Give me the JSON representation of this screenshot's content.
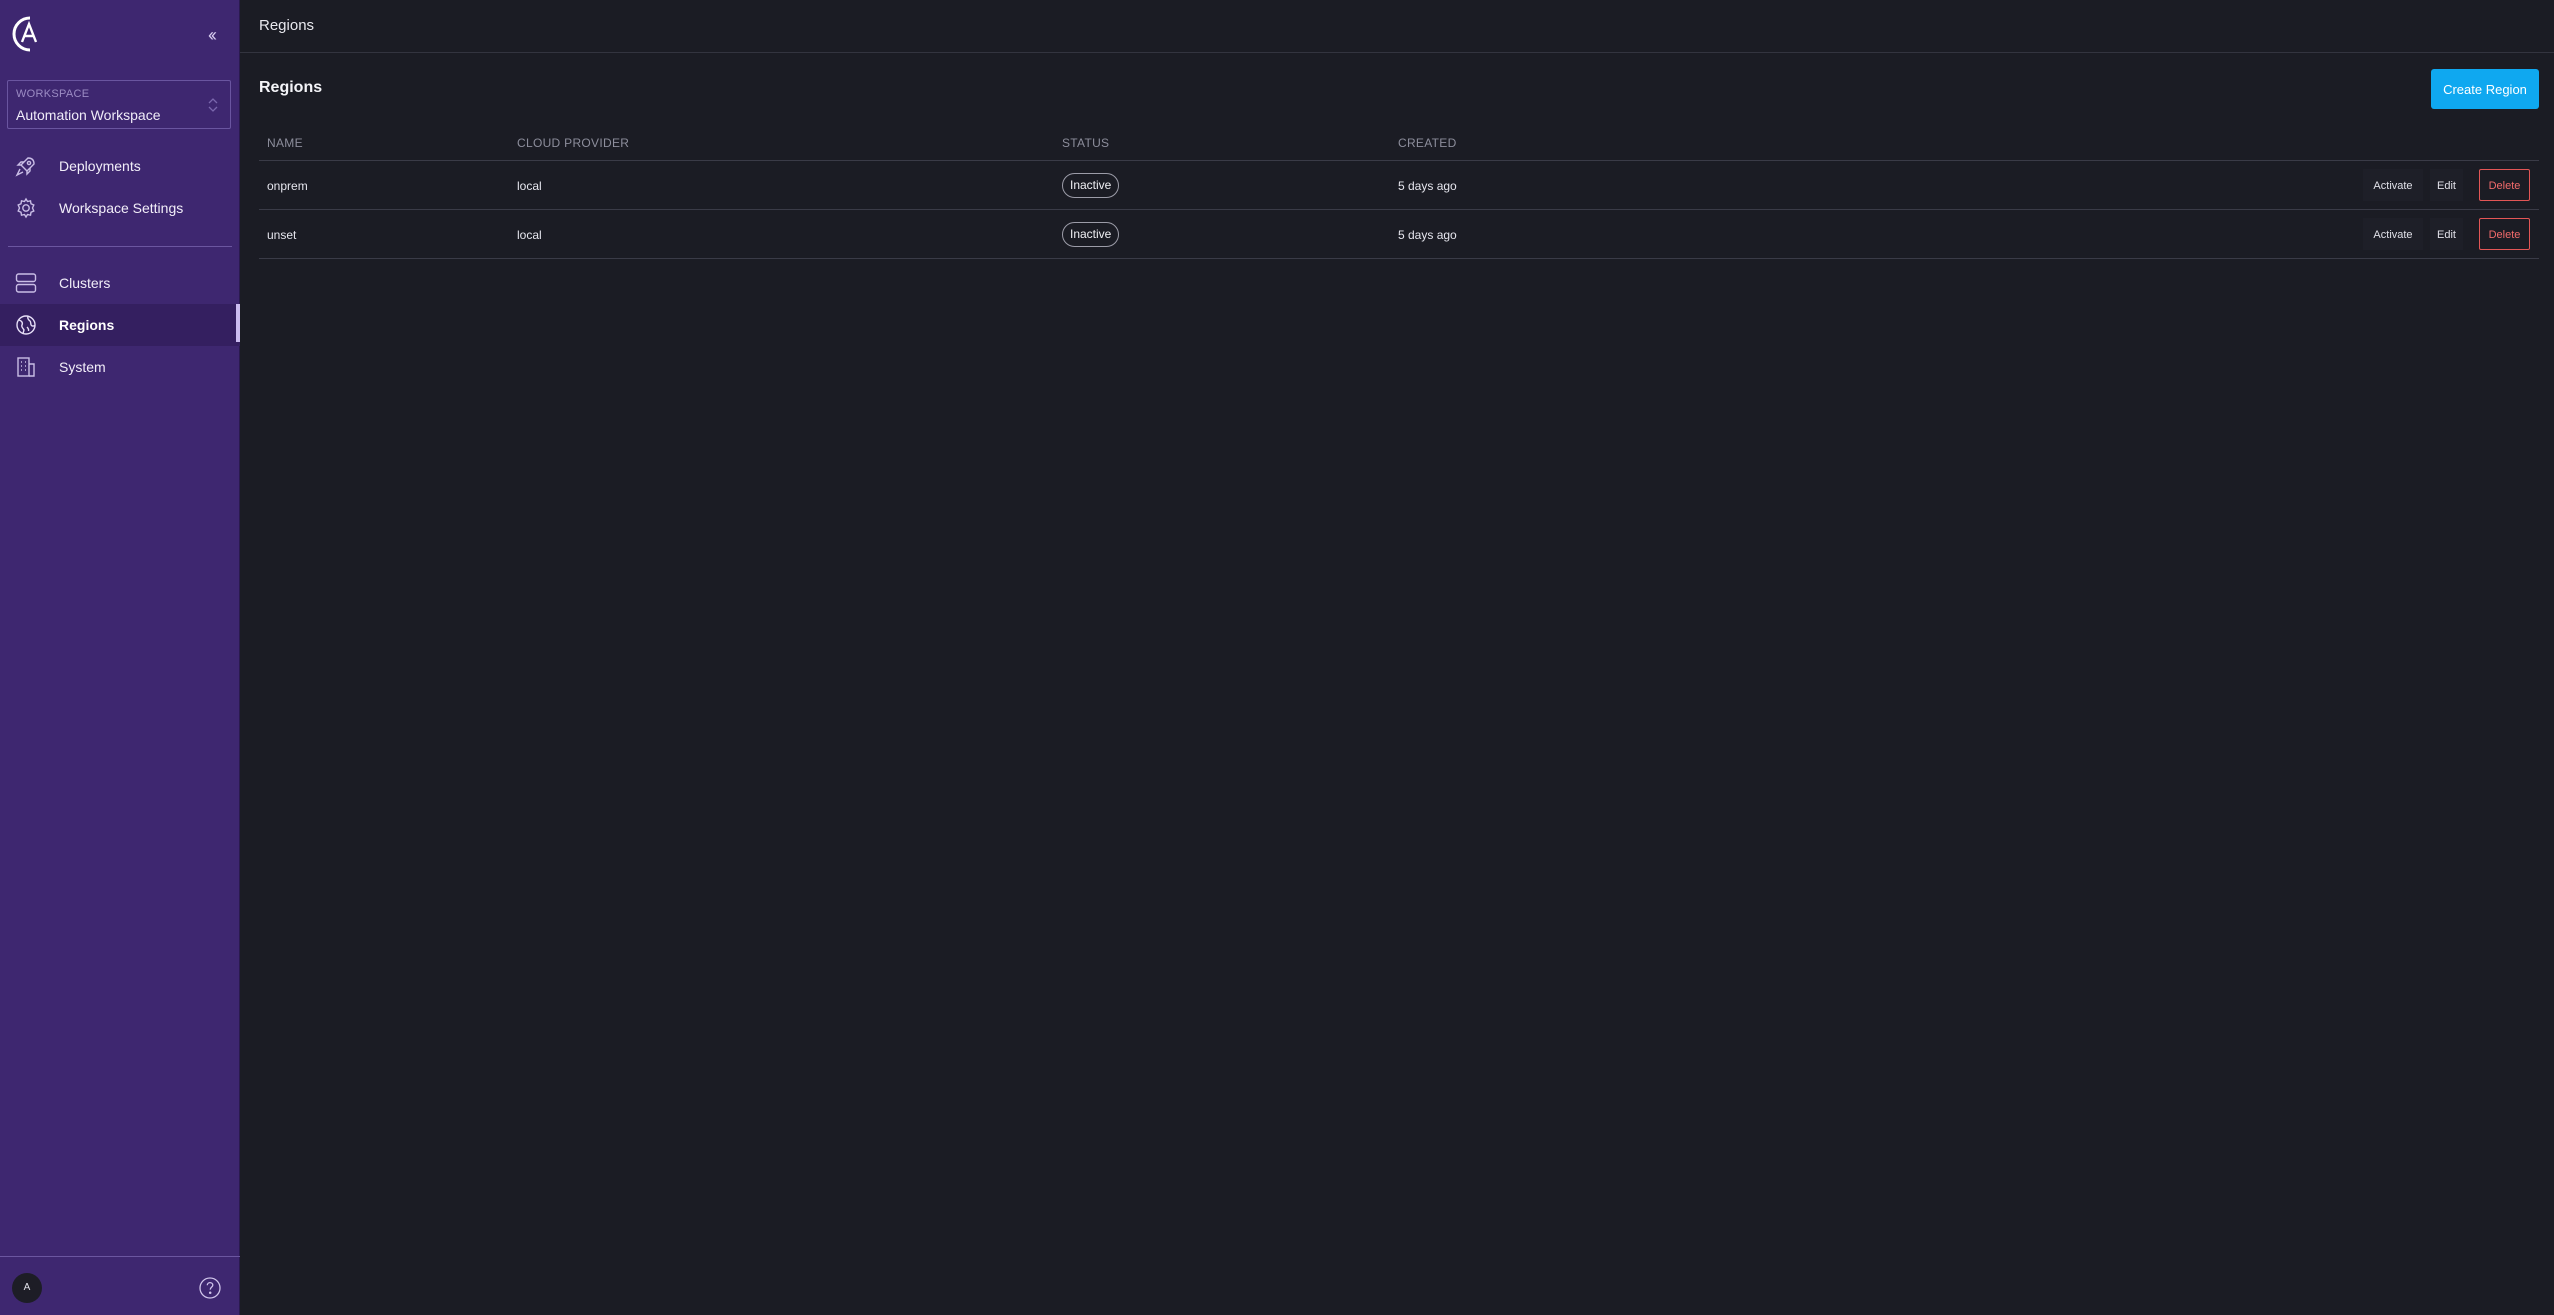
{
  "sidebar": {
    "collapse_glyph": "‹‹",
    "workspace": {
      "label": "WORKSPACE",
      "value": "Automation Workspace"
    },
    "nav_top": [
      {
        "label": "Deployments",
        "icon": "rocket-icon"
      },
      {
        "label": "Workspace Settings",
        "icon": "gear-icon"
      }
    ],
    "nav_bottom": [
      {
        "label": "Clusters",
        "icon": "server-stack-icon"
      },
      {
        "label": "Regions",
        "icon": "globe-icon",
        "active": true
      },
      {
        "label": "System",
        "icon": "building-icon"
      }
    ],
    "footer": {
      "avatar_initial": "A",
      "help_icon": "help-circle-icon"
    }
  },
  "topbar": {
    "title": "Regions"
  },
  "main": {
    "title": "Regions",
    "create_button": "Create Region",
    "table": {
      "columns": [
        "NAME",
        "CLOUD PROVIDER",
        "STATUS",
        "CREATED"
      ],
      "rows": [
        {
          "name": "onprem",
          "cloud_provider": "local",
          "status": "Inactive",
          "created": "5 days ago"
        },
        {
          "name": "unset",
          "cloud_provider": "local",
          "status": "Inactive",
          "created": "5 days ago"
        }
      ],
      "actions": {
        "activate": "Activate",
        "edit": "Edit",
        "delete": "Delete"
      }
    }
  },
  "colors": {
    "sidebar_bg": "#3e2770",
    "main_bg": "#1b1c24",
    "primary_button": "#0fa8f0",
    "danger": "#e35656"
  }
}
